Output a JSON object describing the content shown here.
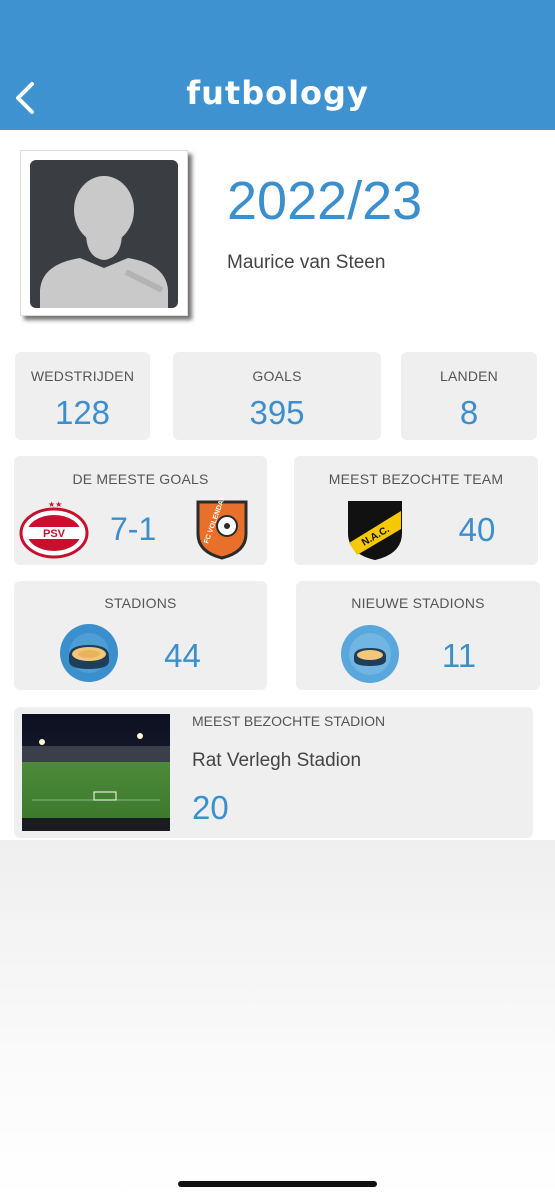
{
  "header": {
    "logo": "futbology",
    "back_icon": "chevron-left-icon",
    "bg_color": "#3e92cf"
  },
  "profile": {
    "season": "2022/23",
    "name": "Maurice van Steen"
  },
  "stats": {
    "matches": {
      "label": "WEDSTRIJDEN",
      "value": "128"
    },
    "goals": {
      "label": "GOALS",
      "value": "395"
    },
    "countries": {
      "label": "LANDEN",
      "value": "8"
    }
  },
  "most_goals": {
    "label": "DE MEESTE GOALS",
    "score": "7-1",
    "home_team_badge": "PSV",
    "away_team_badge": "FC VOLENDAM"
  },
  "most_visited_team": {
    "label": "MEEST BEZOCHTE TEAM",
    "value": "40",
    "team_badge": "N.A.C."
  },
  "stadiums": {
    "label": "STADIONS",
    "value": "44"
  },
  "new_stadiums": {
    "label": "NIEUWE STADIONS",
    "value": "11"
  },
  "most_visited_stadium": {
    "label": "MEEST BEZOCHTE STADION",
    "name": "Rat Verlegh Stadion",
    "value": "20"
  },
  "accent_color": "#3b8fcc"
}
